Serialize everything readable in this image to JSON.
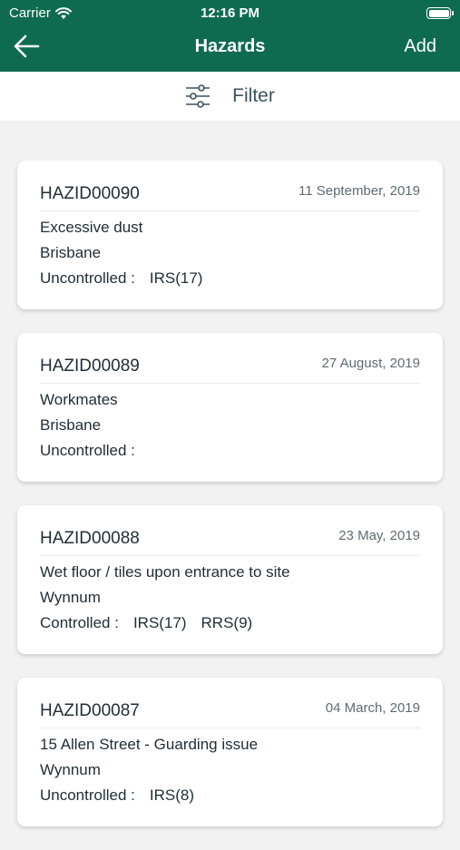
{
  "status_bar": {
    "carrier": "Carrier",
    "time": "12:16 PM"
  },
  "nav": {
    "title": "Hazards",
    "add_label": "Add"
  },
  "filter": {
    "label": "Filter"
  },
  "hazards": [
    {
      "id": "HAZID00090",
      "date": "11 September, 2019",
      "title": "Excessive dust",
      "location": "Brisbane",
      "status": "Uncontrolled :",
      "risks": [
        "IRS(17)"
      ]
    },
    {
      "id": "HAZID00089",
      "date": "27 August, 2019",
      "title": "Workmates",
      "location": "Brisbane",
      "status": "Uncontrolled :",
      "risks": []
    },
    {
      "id": "HAZID00088",
      "date": "23 May, 2019",
      "title": "Wet floor / tiles upon entrance to site",
      "location": "Wynnum",
      "status": "Controlled :",
      "risks": [
        "IRS(17)",
        "RRS(9)"
      ]
    },
    {
      "id": "HAZID00087",
      "date": "04 March, 2019",
      "title": "15 Allen Street - Guarding issue",
      "location": "Wynnum",
      "status": "Uncontrolled :",
      "risks": [
        "IRS(8)"
      ]
    }
  ],
  "colors": {
    "header_bg": "#0e6b50",
    "page_bg": "#f2f2f3",
    "card_bg": "#ffffff"
  }
}
